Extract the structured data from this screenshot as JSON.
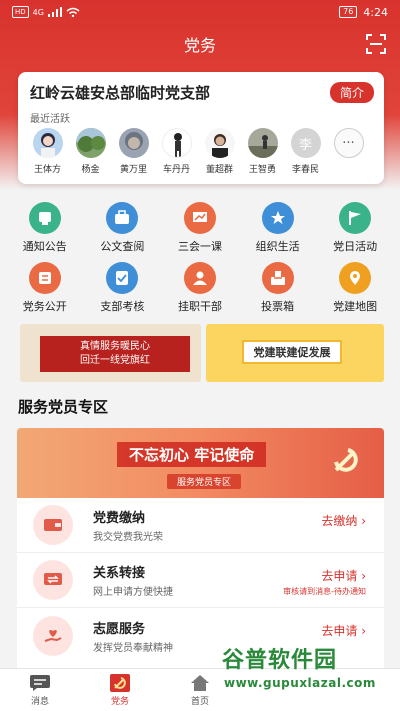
{
  "status_bar": {
    "network_tag": "HD",
    "signal": "4G",
    "battery": "76",
    "time": "4:24"
  },
  "titlebar": {
    "title": "党务"
  },
  "org_card": {
    "name": "红岭云雄安总部临时党支部",
    "intro_button": "简介",
    "recent_label": "最近活跃",
    "more_label": "···",
    "members": [
      {
        "name": "王体方"
      },
      {
        "name": "杨金"
      },
      {
        "name": "黄万里"
      },
      {
        "name": "车丹丹"
      },
      {
        "name": "董超群"
      },
      {
        "name": "王智勇"
      },
      {
        "name": "李春民",
        "avatar_text": "李"
      }
    ]
  },
  "features": [
    {
      "label": "通知公告",
      "icon": "notice-icon",
      "color": "#3bb38a"
    },
    {
      "label": "公文查阅",
      "icon": "briefcase-icon",
      "color": "#3f8fd8"
    },
    {
      "label": "三会一课",
      "icon": "presentation-icon",
      "color": "#ea6a44"
    },
    {
      "label": "组织生活",
      "icon": "star-icon",
      "color": "#3f8fd8"
    },
    {
      "label": "党日活动",
      "icon": "flag-icon",
      "color": "#3bb38a"
    },
    {
      "label": "党务公开",
      "icon": "document-icon",
      "color": "#ea6a44"
    },
    {
      "label": "支部考核",
      "icon": "checklist-icon",
      "color": "#3f8fd8"
    },
    {
      "label": "挂职干部",
      "icon": "person-icon",
      "color": "#ea6a44"
    },
    {
      "label": "投票箱",
      "icon": "ballot-box-icon",
      "color": "#ea6a44"
    },
    {
      "label": "党建地图",
      "icon": "map-pin-icon",
      "color": "#f0a020"
    }
  ],
  "banners": {
    "left_line1": "真情服务暖民心",
    "left_line2": "回迁一线党旗红",
    "right": "党建联建促发展"
  },
  "service_section": {
    "title": "服务党员专区",
    "slogan": "不忘初心 牢记使命",
    "banner_sub": "服务党员专区",
    "items": [
      {
        "title": "党费缴纳",
        "subtitle": "我交党费我光荣",
        "action": "去缴纳 ›",
        "note": ""
      },
      {
        "title": "关系转接",
        "subtitle": "网上申请方便快捷",
        "action": "去申请 ›",
        "note": "审核请到消息-待办通知"
      },
      {
        "title": "志愿服务",
        "subtitle": "发挥党员奉献精神",
        "action": "去申请 ›",
        "note": ""
      }
    ]
  },
  "tabs": [
    {
      "label": "消息",
      "icon": "message-icon"
    },
    {
      "label": "党务",
      "icon": "party-emblem-icon"
    },
    {
      "label": "首页",
      "icon": "home-icon"
    }
  ],
  "watermark": {
    "title": "谷普软件园",
    "url": "www.gupuxlazal.com"
  },
  "colors": {
    "primary": "#d8322d",
    "accent_green": "#2a8a3a"
  }
}
